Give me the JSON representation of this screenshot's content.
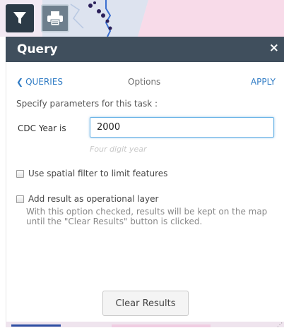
{
  "toolbar": {
    "filter_icon": "filter-icon",
    "print_icon": "printer-icon"
  },
  "panel": {
    "title": "Query",
    "close_glyph": "×"
  },
  "nav": {
    "back_chevron": "❮",
    "back_label": "QUERIES",
    "center_label": "Options",
    "apply_label": "APPLY"
  },
  "form": {
    "instructions": "Specify parameters for this task :",
    "field_label": "CDC Year is",
    "field_value": "2000",
    "field_hint": "Four digit year"
  },
  "options": {
    "spatial_label": "Use spatial filter to limit features",
    "operational_label": "Add result as operational layer",
    "operational_help": "With this option checked, results will be kept on the map until the \"Clear Results\" button is clicked."
  },
  "actions": {
    "clear_label": "Clear Results"
  },
  "colors": {
    "header_bg": "#404f5d",
    "link": "#2f7bc4",
    "input_focus": "#6ab3e6"
  }
}
